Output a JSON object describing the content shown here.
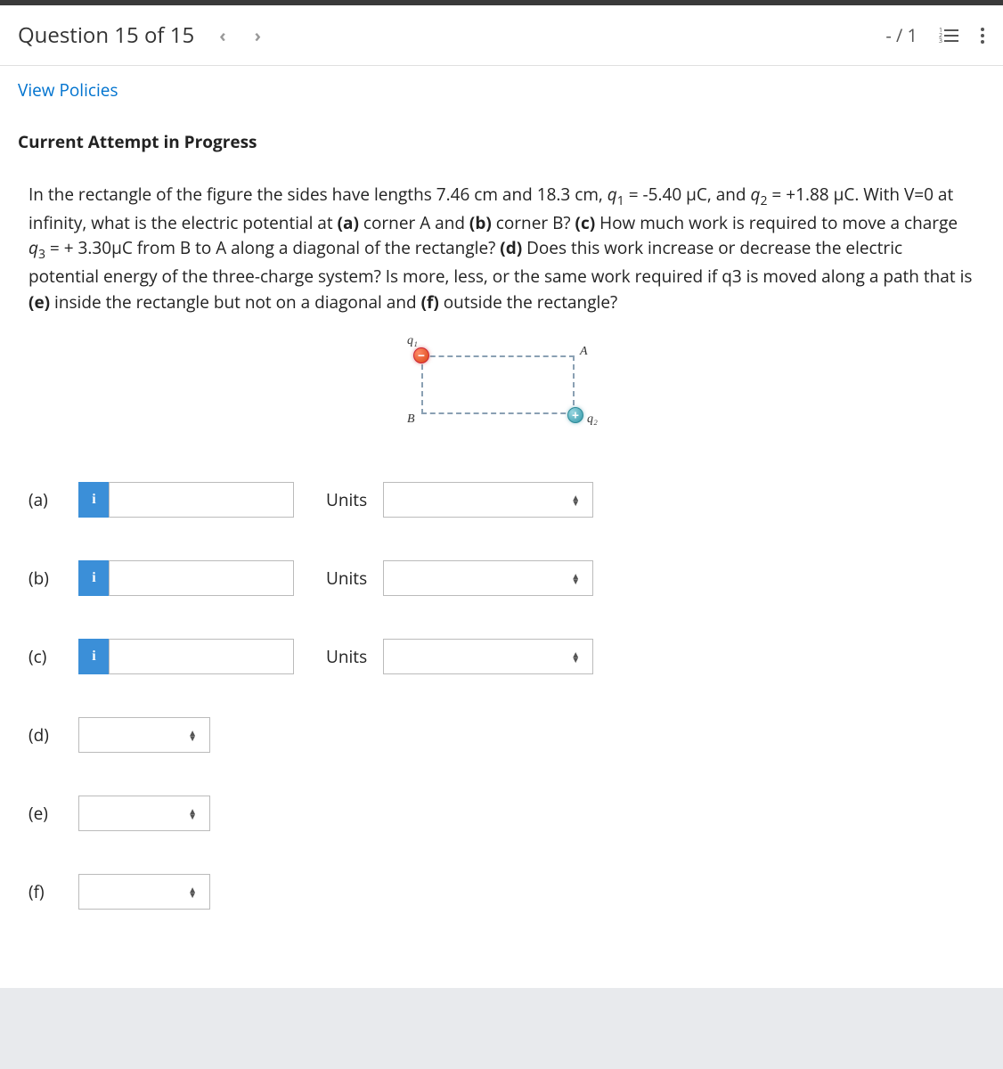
{
  "header": {
    "question_label": "Question 15 of 15",
    "score": "- / 1"
  },
  "policies_link": "View Policies",
  "attempt_label": "Current Attempt in Progress",
  "question": {
    "text_pre": "In the rectangle of the figure the sides have lengths 7.46 cm and 18.3 cm, ",
    "q1_sym": "q",
    "q1_sub": "1",
    "eq1": " = -5.40 μC, and ",
    "q2_sym": "q",
    "q2_sub": "2",
    "eq2": " = +1.88 μC. With V=0 at infinity, what is the electric potential at ",
    "part_a_b": "(a) corner A and (b) corner B? (c) How much work is required to move a charge ",
    "q3_sym": "q",
    "q3_sub": "3",
    "q3_val": " = + 3.30μC from B to A along a diagonal of the rectangle? ",
    "part_d": "(d) Does this work increase or decrease the electric potential energy of the three-charge system? Is more, less, or the same work required if q3 is moved along a path that is ",
    "part_e": "(e) inside the rectangle but not on a diagonal and ",
    "part_f": "(f) outside the rectangle?"
  },
  "figure": {
    "q1": "q₁",
    "q2": "q₂",
    "A": "A",
    "B": "B"
  },
  "parts": {
    "a": "(a)",
    "b": "(b)",
    "c": "(c)",
    "d": "(d)",
    "e": "(e)",
    "f": "(f)"
  },
  "units_label": "Units",
  "info_icon": "i"
}
